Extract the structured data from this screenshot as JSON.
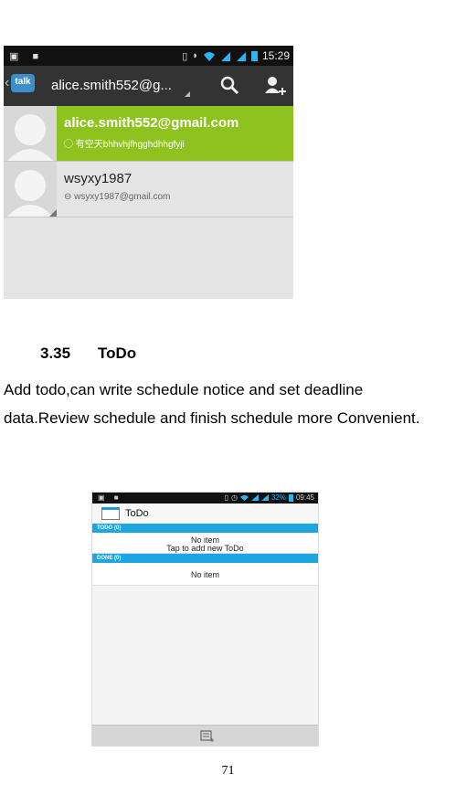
{
  "talk_screen": {
    "status_bar": {
      "time": "15:29"
    },
    "action_bar": {
      "logo_text": "talk",
      "account": "alice.smith552@g..."
    },
    "contacts": [
      {
        "name": "alice.smith552@gmail.com",
        "status": "有空天bhhvhjfhgghdhhgfyji"
      },
      {
        "name": "wsyxy1987",
        "status": "wsyxy1987@gmail.com"
      }
    ]
  },
  "section": {
    "number": "3.35",
    "title": "ToDo",
    "body": "Add todo,can write schedule notice and set deadline data.Review schedule and finish schedule more Convenient."
  },
  "todo_screen": {
    "status_bar": {
      "battery": "32%",
      "time": "09:45"
    },
    "title": "ToDo",
    "todo_header": "TODO (0)",
    "todo_empty": "No item",
    "todo_hint": "Tap to add new ToDo",
    "done_header": "DONE (0)",
    "done_empty": "No item"
  },
  "page_number": "71",
  "colors": {
    "selected_row": "#8ec21f",
    "section_header": "#1ea6e0",
    "talk_logo": "#3b8ec8"
  }
}
